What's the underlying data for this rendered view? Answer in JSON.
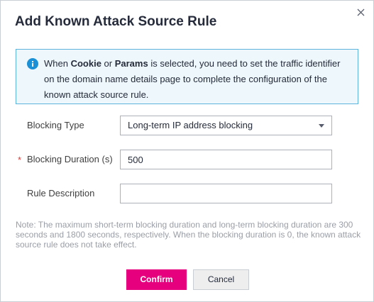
{
  "dialog": {
    "title": "Add Known Attack Source Rule",
    "close_icon": "close-icon"
  },
  "notice": {
    "icon": "info-icon",
    "text_1": "When ",
    "keyword_1": "Cookie",
    "text_2": " or ",
    "keyword_2": "Params",
    "text_3": " is selected, you need to set the traffic identifier on the domain name details page to complete the configuration of the known attack source rule."
  },
  "form": {
    "blocking_type": {
      "label": "Blocking Type",
      "value": "Long-term IP address blocking"
    },
    "blocking_duration": {
      "required_mark": "*",
      "label": "Blocking Duration (s)",
      "value": "500"
    },
    "rule_description": {
      "label": "Rule Description",
      "value": ""
    }
  },
  "note": "Note: The maximum short-term blocking duration and long-term blocking duration are 300 seconds and 1800 seconds, respectively. When the blocking duration is 0, the known attack source rule does not take effect.",
  "buttons": {
    "confirm": "Confirm",
    "cancel": "Cancel"
  },
  "colors": {
    "primary": "#e6007e",
    "info": "#1a91d6",
    "required": "#e53935"
  }
}
